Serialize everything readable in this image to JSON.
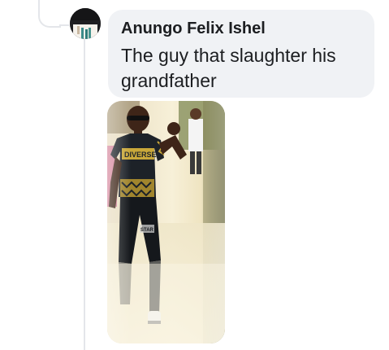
{
  "comment": {
    "author": "Anungo Felix Ishel",
    "text": "The guy that slaughter his grandfather"
  },
  "icons": {
    "avatar": "profile-photo-icon",
    "attachment": "photo-attachment"
  },
  "colors": {
    "bubble_background": "#f0f2f5",
    "thread_line": "#e4e6ea",
    "text": "#1c1e21"
  }
}
